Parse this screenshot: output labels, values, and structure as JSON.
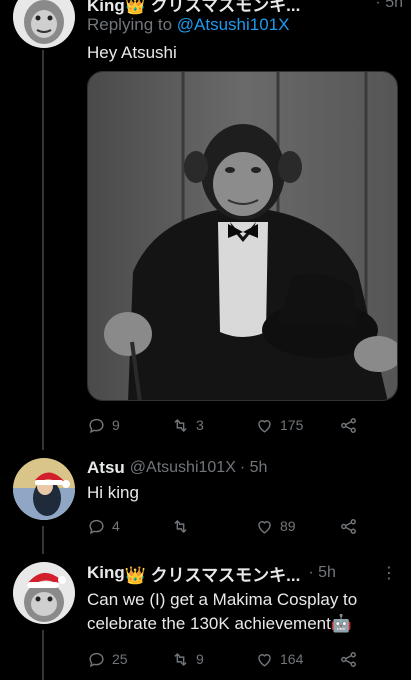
{
  "tweet1": {
    "name": "King👑 クリスマスモンキ...",
    "time": "· 5h",
    "replying_prefix": "Replying to ",
    "replying_handle": "@Atsushi101X",
    "text": "Hey Atsushi",
    "image_alt": "chimpanzee in a tuxedo holding a top hat and cane",
    "replies": "9",
    "retweets": "3",
    "likes": "175"
  },
  "tweet2": {
    "name": "Atsu",
    "handle": "@Atsushi101X",
    "time": "· 5h",
    "text": "Hi king",
    "replies": "4",
    "retweets": "",
    "likes": "89"
  },
  "tweet3": {
    "name": "King",
    "name_suffix": "👑 クリスマスモンキ...",
    "time": "· 5h",
    "more": "⋮",
    "text": "Can we (I) get a Makima Cosplay to celebrate the 130K achievement🤖",
    "replies": "25",
    "retweets": "9",
    "likes": "164"
  },
  "colors": {
    "accent": "#1d9bf0",
    "muted": "#71767b",
    "background": "#000000"
  }
}
